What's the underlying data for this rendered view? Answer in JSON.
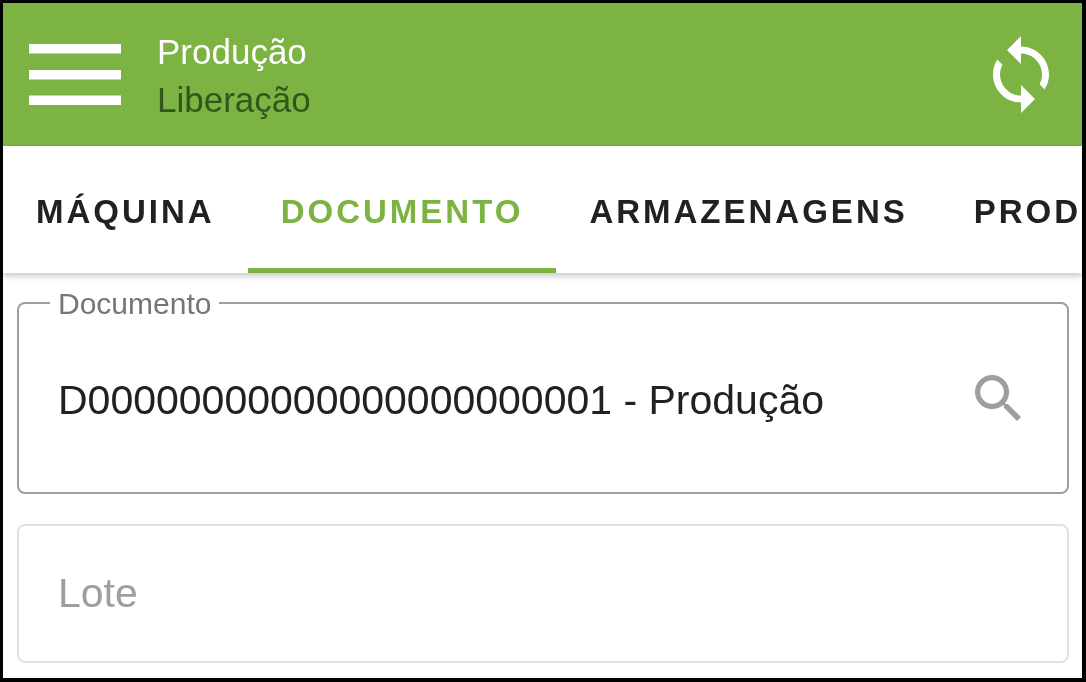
{
  "app_bar": {
    "title": "Produção",
    "subtitle": "Liberação"
  },
  "tabs": [
    {
      "label": "MÁQUINA",
      "selected": false
    },
    {
      "label": "DOCUMENTO",
      "selected": true
    },
    {
      "label": "ARMAZENAGENS",
      "selected": false
    },
    {
      "label": "PROD",
      "selected": false
    }
  ],
  "fields": [
    {
      "kind": "lookup",
      "label": "Documento",
      "value": "D00000000000000000000001 - Produção"
    },
    {
      "kind": "text",
      "placeholder": "Lote"
    }
  ]
}
